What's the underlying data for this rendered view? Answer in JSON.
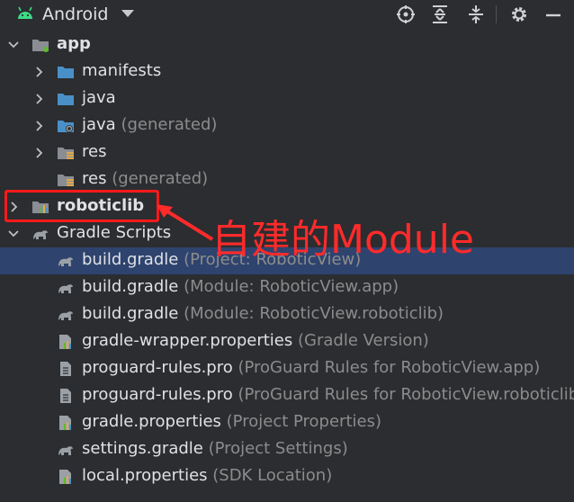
{
  "toolbar": {
    "title": "Android",
    "icons": [
      "locate-icon",
      "expand-all-icon",
      "collapse-all-icon",
      "settings-icon",
      "minimize-icon"
    ]
  },
  "tree": [
    {
      "label": "app",
      "hint": "",
      "bold": true,
      "expanded": true,
      "icon": "module-folder-icon"
    },
    {
      "label": "manifests",
      "hint": "",
      "icon": "folder-icon"
    },
    {
      "label": "java",
      "hint": "",
      "icon": "folder-icon"
    },
    {
      "label": "java",
      "hint": " (generated)",
      "icon": "generated-folder-icon"
    },
    {
      "label": "res",
      "hint": "",
      "icon": "res-folder-icon"
    },
    {
      "label": "res",
      "hint": " (generated)",
      "icon": "res-folder-icon"
    },
    {
      "label": "roboticlib",
      "hint": "",
      "bold": true,
      "icon": "library-module-icon"
    },
    {
      "label": "Gradle Scripts",
      "hint": "",
      "icon": "gradle-icon"
    },
    {
      "label": "build.gradle",
      "hint": " (Project: RoboticView)",
      "icon": "gradle-icon",
      "selected": true
    },
    {
      "label": "build.gradle",
      "hint": " (Module: RoboticView.app)",
      "icon": "gradle-icon"
    },
    {
      "label": "build.gradle",
      "hint": " (Module: RoboticView.roboticlib)",
      "icon": "gradle-icon"
    },
    {
      "label": "gradle-wrapper.properties",
      "hint": " (Gradle Version)",
      "icon": "properties-icon"
    },
    {
      "label": "proguard-rules.pro",
      "hint": " (ProGuard Rules for RoboticView.app)",
      "icon": "text-file-icon"
    },
    {
      "label": "proguard-rules.pro",
      "hint": " (ProGuard Rules for RoboticView.roboticlib)",
      "icon": "text-file-icon"
    },
    {
      "label": "gradle.properties",
      "hint": " (Project Properties)",
      "icon": "properties-icon"
    },
    {
      "label": "settings.gradle",
      "hint": " (Project Settings)",
      "icon": "gradle-icon"
    },
    {
      "label": "local.properties",
      "hint": " (SDK Location)",
      "icon": "properties-icon"
    }
  ],
  "annotation": {
    "text": "自建的Module",
    "color": "#ff2b2b"
  },
  "colors": {
    "background": "#2b2d30",
    "selection": "#2e436e",
    "folder_blue": "#4a90c8",
    "hint_gray": "#8c8c8c"
  }
}
